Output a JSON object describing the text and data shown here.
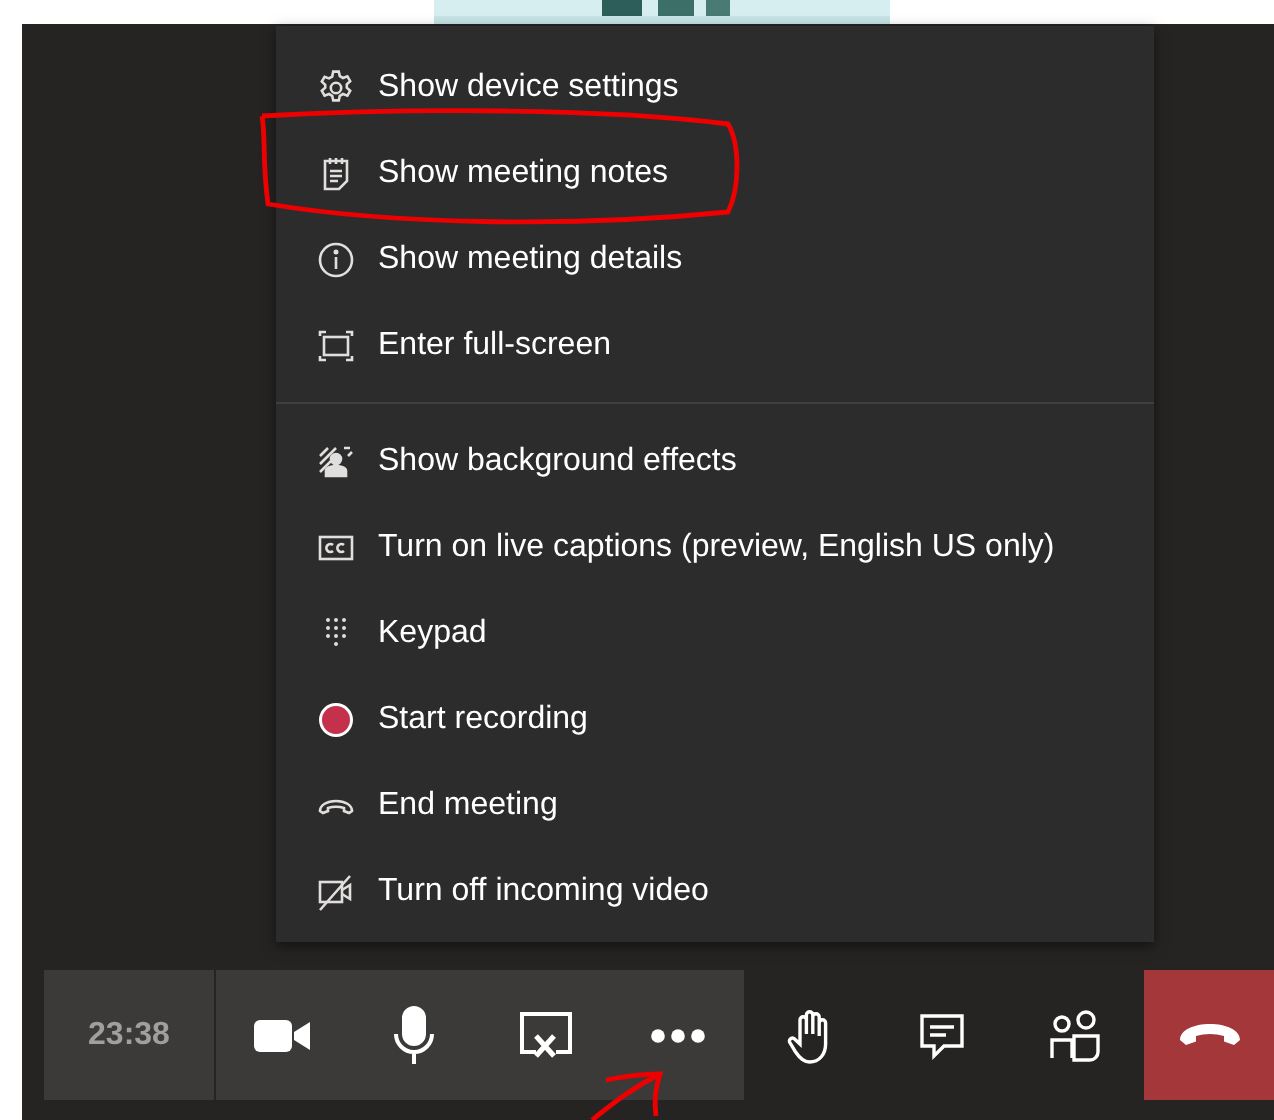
{
  "more_menu": {
    "sections": [
      {
        "items": [
          {
            "label": "Show device settings"
          },
          {
            "label": "Show meeting notes"
          },
          {
            "label": "Show meeting details"
          },
          {
            "label": "Enter full-screen"
          }
        ]
      },
      {
        "items": [
          {
            "label": "Show background effects"
          },
          {
            "label": "Turn on live captions (preview, English US only)"
          },
          {
            "label": "Keypad"
          },
          {
            "label": "Start recording"
          },
          {
            "label": "End meeting"
          },
          {
            "label": "Turn off incoming video"
          }
        ]
      }
    ]
  },
  "call_bar": {
    "timer": "23:38"
  }
}
